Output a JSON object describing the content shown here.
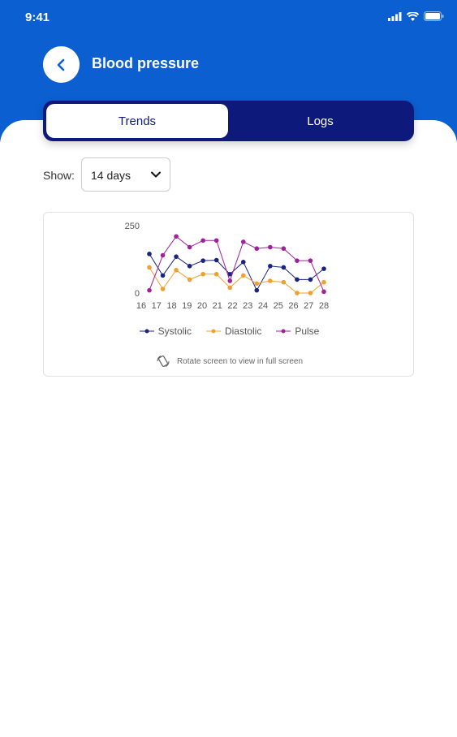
{
  "status_bar": {
    "time": "9:41"
  },
  "header": {
    "title": "Blood pressure"
  },
  "tabs": [
    {
      "label": "Trends",
      "active": true
    },
    {
      "label": "Logs",
      "active": false
    }
  ],
  "filter": {
    "label": "Show:",
    "value": "14 days"
  },
  "chart_data": {
    "type": "line",
    "x": [
      "16",
      "17",
      "18",
      "19",
      "20",
      "21",
      "22",
      "23",
      "24",
      "25",
      "26",
      "27",
      "28"
    ],
    "ylim": [
      0,
      250
    ],
    "yticks": [
      "250",
      "0"
    ],
    "series": [
      {
        "name": "Systolic",
        "color": "#1a237e",
        "values": [
          145,
          65,
          135,
          100,
          120,
          122,
          70,
          115,
          10,
          100,
          95,
          50,
          50,
          90
        ]
      },
      {
        "name": "Diastolic",
        "color": "#f0a030",
        "values": [
          95,
          15,
          85,
          50,
          70,
          70,
          20,
          65,
          35,
          45,
          40,
          0,
          0,
          40
        ]
      },
      {
        "name": "Pulse",
        "color": "#a020a0",
        "values": [
          10,
          140,
          210,
          170,
          195,
          195,
          45,
          190,
          165,
          170,
          165,
          120,
          120,
          5
        ]
      }
    ]
  },
  "chart_note": "Rotate screen to view in full screen"
}
